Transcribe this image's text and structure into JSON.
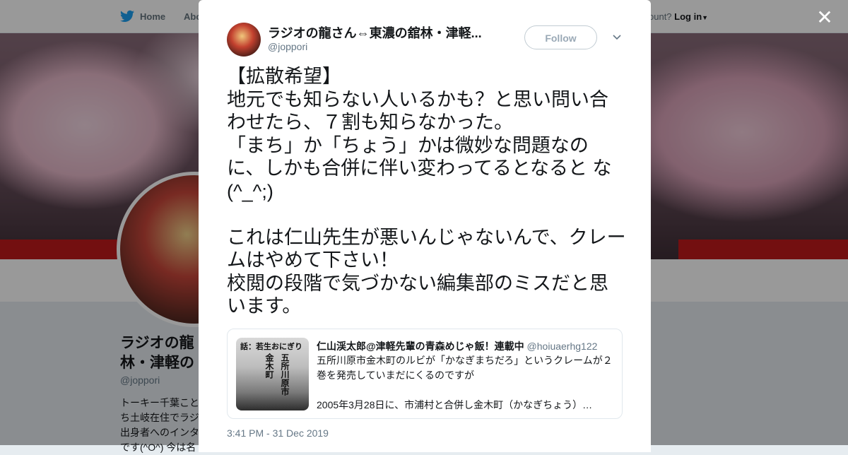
{
  "nav": {
    "home_label": "Home",
    "about_label": "Abo",
    "account_prompt": "ccount?",
    "login_label": "Log in"
  },
  "profile": {
    "name": "ラジオの龍\n林・津軽の",
    "handle": "@joppori",
    "bio": "トーキー千葉こと\nち土岐在住でラジ\n出身者へのインタ\nです(^O^) 今は名"
  },
  "tweet": {
    "author_name": "ラジオの龍さん⇔東濃の舘林・津軽...",
    "author_handle": "@joppori",
    "follow_label": "Follow",
    "text": "【拡散希望】\n地元でも知らない人いるかも？と思い問い合わせたら、７割も知らなかった。\n「まち」か「ちょう」かは微妙な問題なのに、しかも合併に伴い変わってるとなると な(^_^;)\n\nこれは仁山先生が悪いんじゃないんで、クレームはやめて下さい！\n校閲の段階で気づかない編集部のミスだと思います。",
    "timestamp": "3:41 PM - 31 Dec 2019"
  },
  "quote": {
    "author_name": "仁山渓太郎@津軽先輩の青森めじゃ飯！連載中",
    "author_handle": "@hoiuaerhg122",
    "text": "五所川原市金木町のルビが「かなぎまちだろ」というクレームが２巻を発売していまだにくるのですが\n\n2005年3月28日に、市浦村と合併し金木町（かなぎちょう）…",
    "image_banner_text": "話：若生おにぎり",
    "image_vertical_text_1": "五所川原市",
    "image_vertical_text_2": "金木町"
  },
  "colors": {
    "accent": "#1da1f2",
    "text": "#14171a",
    "muted": "#657786",
    "border": "#e1e8ed"
  }
}
